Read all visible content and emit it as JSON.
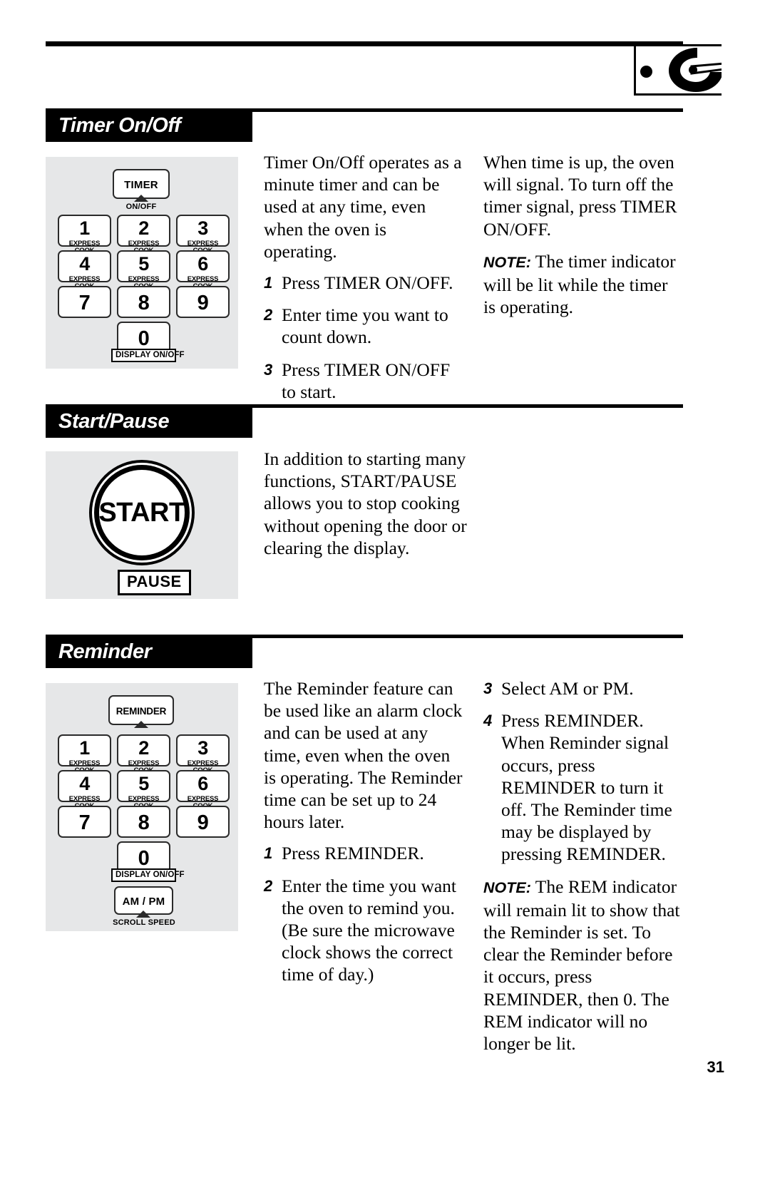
{
  "page": {
    "number": "31"
  },
  "corner_icon": {
    "name": "microwave-dial-icon"
  },
  "sections": [
    {
      "id": "timer",
      "title": "Timer On/Off",
      "keypad": {
        "main_key": {
          "label": "TIMER",
          "caption": "ON/OFF"
        },
        "keys": [
          {
            "num": "1",
            "sub": "EXPRESS COOK"
          },
          {
            "num": "2",
            "sub": "EXPRESS COOK"
          },
          {
            "num": "3",
            "sub": "EXPRESS COOK"
          },
          {
            "num": "4",
            "sub": "EXPRESS COOK"
          },
          {
            "num": "5",
            "sub": "EXPRESS COOK"
          },
          {
            "num": "6",
            "sub": "EXPRESS COOK"
          },
          {
            "num": "7",
            "sub": ""
          },
          {
            "num": "8",
            "sub": ""
          },
          {
            "num": "9",
            "sub": ""
          },
          {
            "num": "0",
            "sub": ""
          }
        ],
        "zero_caption": "DISPLAY ON/OFF"
      },
      "column_left": {
        "intro": "Timer On/Off operates as a minute timer and can be used at any time, even when the oven is operating.",
        "steps": [
          {
            "n": "1",
            "text": "Press TIMER ON/OFF."
          },
          {
            "n": "2",
            "text": "Enter time you want to count down."
          },
          {
            "n": "3",
            "text": "Press TIMER ON/OFF to start."
          }
        ]
      },
      "column_right": {
        "paragraph": "When time is up, the oven will signal. To turn off the timer signal, press TIMER ON/OFF.",
        "note_label": "NOTE:",
        "note_text": " The timer indicator will be lit while the timer is operating."
      }
    },
    {
      "id": "start-pause",
      "title": "Start/Pause",
      "button": {
        "label": "START",
        "sub_label": "PAUSE"
      },
      "column_left": {
        "paragraph": "In addition to starting many functions, START/PAUSE allows you to stop cooking without opening the door or clearing the display."
      }
    },
    {
      "id": "reminder",
      "title": "Reminder",
      "keypad": {
        "main_key": {
          "label": "REMINDER",
          "caption": ""
        },
        "keys": [
          {
            "num": "1",
            "sub": "EXPRESS COOK"
          },
          {
            "num": "2",
            "sub": "EXPRESS COOK"
          },
          {
            "num": "3",
            "sub": "EXPRESS COOK"
          },
          {
            "num": "4",
            "sub": "EXPRESS COOK"
          },
          {
            "num": "5",
            "sub": "EXPRESS COOK"
          },
          {
            "num": "6",
            "sub": "EXPRESS COOK"
          },
          {
            "num": "7",
            "sub": ""
          },
          {
            "num": "8",
            "sub": ""
          },
          {
            "num": "9",
            "sub": ""
          },
          {
            "num": "0",
            "sub": ""
          }
        ],
        "zero_caption": "DISPLAY ON/OFF",
        "ampm_key": {
          "label": "AM / PM",
          "caption": "SCROLL SPEED"
        }
      },
      "column_left": {
        "intro": "The Reminder feature can be used like an alarm clock and can be used at any time, even when the oven is operating. The Reminder time can be set up to 24 hours later.",
        "steps": [
          {
            "n": "1",
            "text": "Press REMINDER."
          },
          {
            "n": "2",
            "text": "Enter the time you want the oven to remind you. (Be sure the microwave clock shows the correct time of day.)"
          }
        ]
      },
      "column_right": {
        "steps": [
          {
            "n": "3",
            "text": "Select AM or PM."
          },
          {
            "n": "4",
            "text": "Press REMINDER. When Reminder signal occurs, press REMINDER to turn it off. The Reminder time may be displayed by pressing REMINDER."
          }
        ],
        "note_label": "NOTE:",
        "note_text": " The REM indicator will remain lit to show that the Reminder is set. To clear the Reminder before it occurs, press REMINDER, then 0. The REM indicator will no longer be lit."
      }
    }
  ]
}
